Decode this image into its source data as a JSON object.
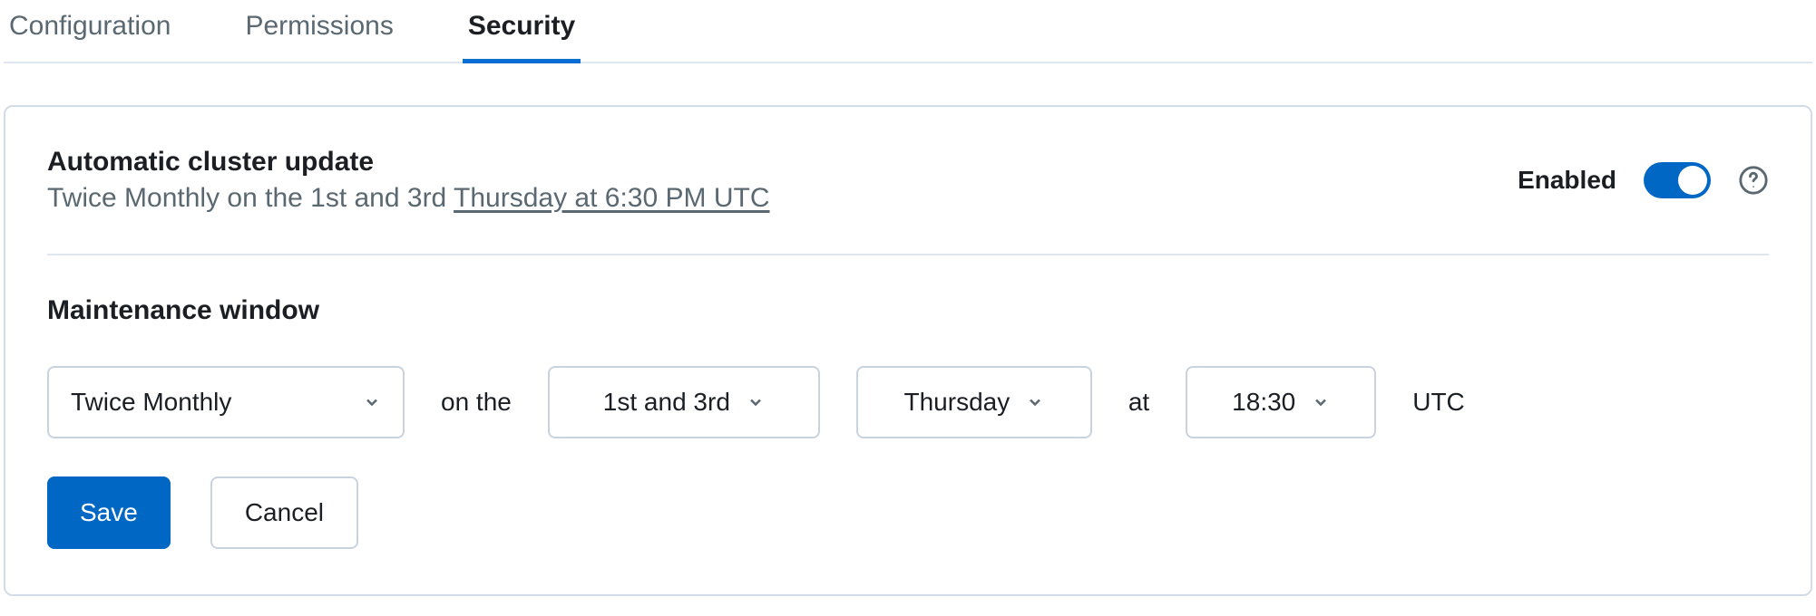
{
  "tabs": {
    "configuration": "Configuration",
    "permissions": "Permissions",
    "security": "Security"
  },
  "auto_update": {
    "title": "Automatic cluster update",
    "subtitle_prefix": "Twice Monthly on the 1st and 3rd ",
    "subtitle_link": "Thursday at 6:30 PM UTC",
    "enabled_label": "Enabled"
  },
  "maintenance": {
    "section_title": "Maintenance window",
    "frequency": "Twice Monthly",
    "on_the": "on the",
    "ordinal": "1st and 3rd",
    "day": "Thursday",
    "at": "at",
    "time": "18:30",
    "tz": "UTC"
  },
  "buttons": {
    "save": "Save",
    "cancel": "Cancel"
  }
}
